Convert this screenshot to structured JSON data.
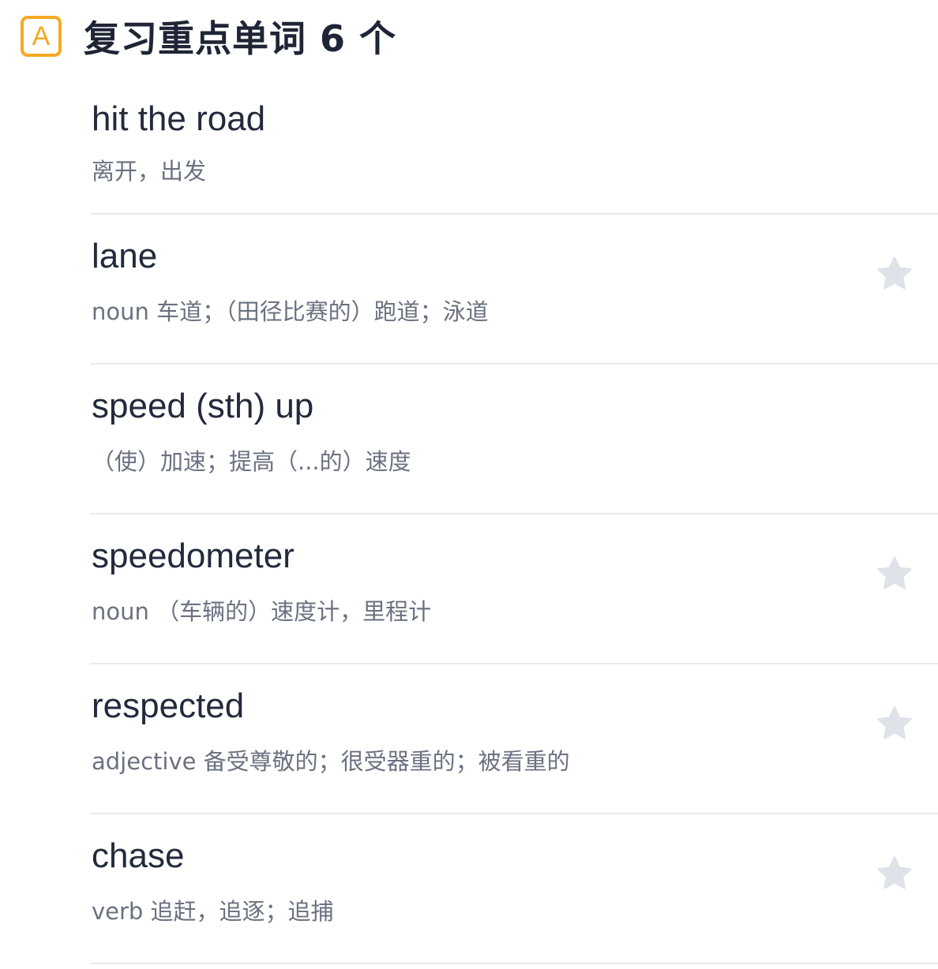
{
  "header": {
    "badge_letter": "A",
    "title": "复习重点单词 6 个"
  },
  "colors": {
    "accent": "#f7a823",
    "word": "#232a3c",
    "definition": "#6b7181",
    "divider": "#e7e9ee",
    "star": "#dfe2e8"
  },
  "words": [
    {
      "word": "hit the road",
      "definition": "离开，出发",
      "star": false
    },
    {
      "word": "lane",
      "definition": "noun 车道；（田径比赛的）跑道；泳道",
      "star": true,
      "star_icon": "star-icon"
    },
    {
      "word": "speed (sth) up",
      "definition": "（使）加速；提高（...的）速度",
      "star": false
    },
    {
      "word": "speedometer",
      "definition": "noun （车辆的）速度计，里程计",
      "star": true,
      "star_icon": "star-icon"
    },
    {
      "word": "respected",
      "definition": "adjective 备受尊敬的；很受器重的；被看重的",
      "star": true,
      "star_icon": "star-icon"
    },
    {
      "word": "chase",
      "definition": "verb 追赶，追逐；追捕",
      "star": true,
      "star_icon": "star-icon"
    }
  ]
}
